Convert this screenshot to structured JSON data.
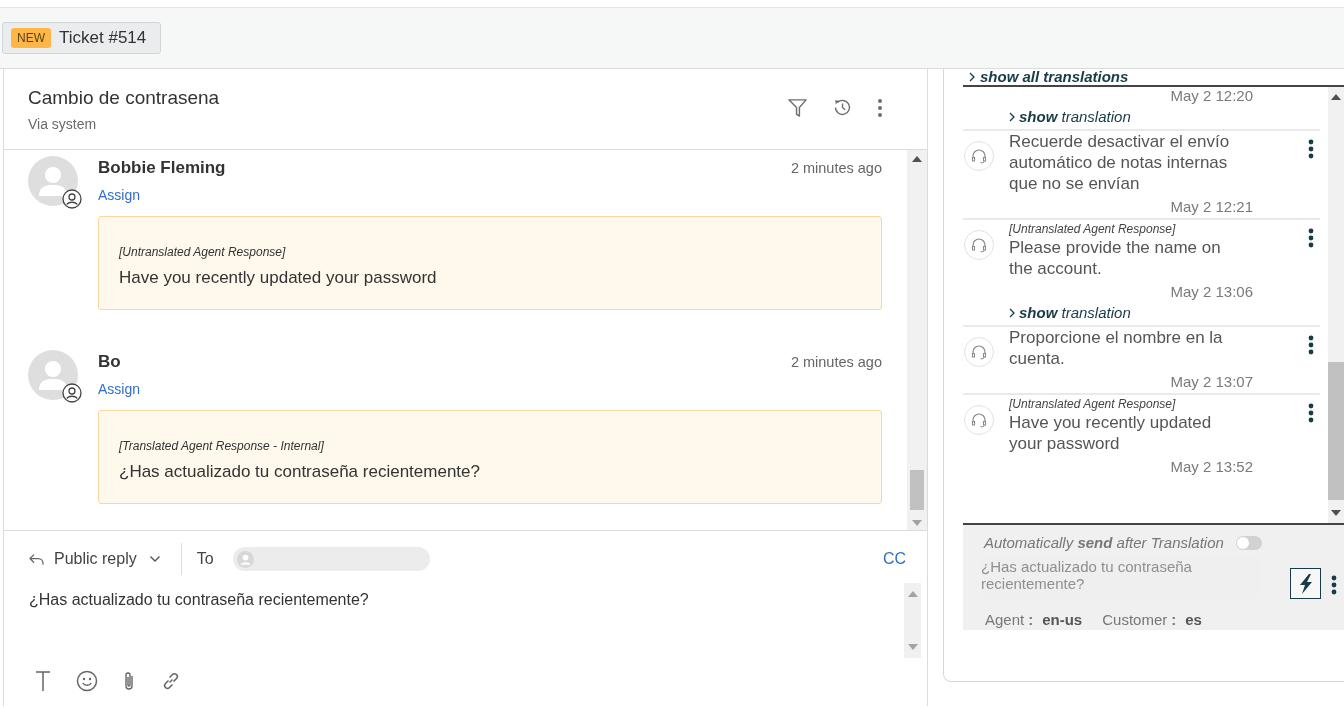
{
  "tabs": [
    {
      "badge": "NEW",
      "label": "Ticket #514",
      "selected": true
    }
  ],
  "ticket": {
    "title": "Cambio de contrasena",
    "subtitle": "Via system"
  },
  "thread": {
    "messages": [
      {
        "author": "Bobbie Fleming",
        "time": "2 minutes ago",
        "assign": "Assign",
        "note_label": "[Untranslated Agent Response]",
        "body": "Have you recently updated your password"
      },
      {
        "author": "Bo",
        "time": "2 minutes ago",
        "assign": "Assign",
        "note_label": "[Translated Agent Response - Internal]",
        "body": "¿Has actualizado tu contraseña recientemente?"
      }
    ]
  },
  "reply": {
    "mode": "Public reply",
    "to_label": "To",
    "cc": "CC",
    "value": "¿Has actualizado tu contraseña recientemente?"
  },
  "translation_panel": {
    "show_all": "show all translations",
    "messages": [
      {
        "time": "May 2 12:20",
        "translation_link": "**show** translation"
      },
      {
        "text": "Recuerde desactivar el envío automático de notas internas que no se envían",
        "time": "May 2 12:21"
      },
      {
        "label": "[Untranslated Agent Response]",
        "text": "Please provide the name on the account.",
        "time": "May 2 13:06",
        "translation_link": "**show** translation"
      },
      {
        "text": "Proporcione el nombre en la cuenta.",
        "time": "May 2 13:07"
      },
      {
        "label": "[Untranslated Agent Response]",
        "text": "Have you recently updated your password",
        "time": "May 2 13:52"
      }
    ],
    "auto_send": {
      "label": "Automatically **send** after Translation",
      "on": false
    },
    "translation_field": {
      "placeholder": "¿Has actualizado tu contraseña recientemente?"
    },
    "languages": [
      {
        "label": "Agent",
        "separator": ":",
        "value": "en-us"
      },
      {
        "label": "Customer",
        "separator": ":",
        "value": "es"
      }
    ]
  }
}
